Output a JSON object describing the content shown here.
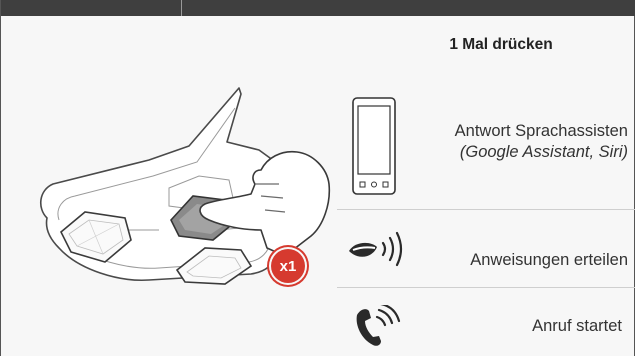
{
  "title": "1 Mal drücken",
  "badge": "x1",
  "rows": [
    {
      "label": "Antwort Sprachassisten",
      "sublabel": "(Google Assistant, Siri)",
      "icon": "smartphone-icon"
    },
    {
      "label": "Anweisungen erteilen",
      "icon": "speaking-mouth-icon"
    },
    {
      "label": "Anruf startet",
      "icon": "phone-call-icon"
    }
  ],
  "colors": {
    "badge": "#d63a2f",
    "topbar": "#3f3f3f",
    "button_pressed": "#8a8a8a"
  }
}
